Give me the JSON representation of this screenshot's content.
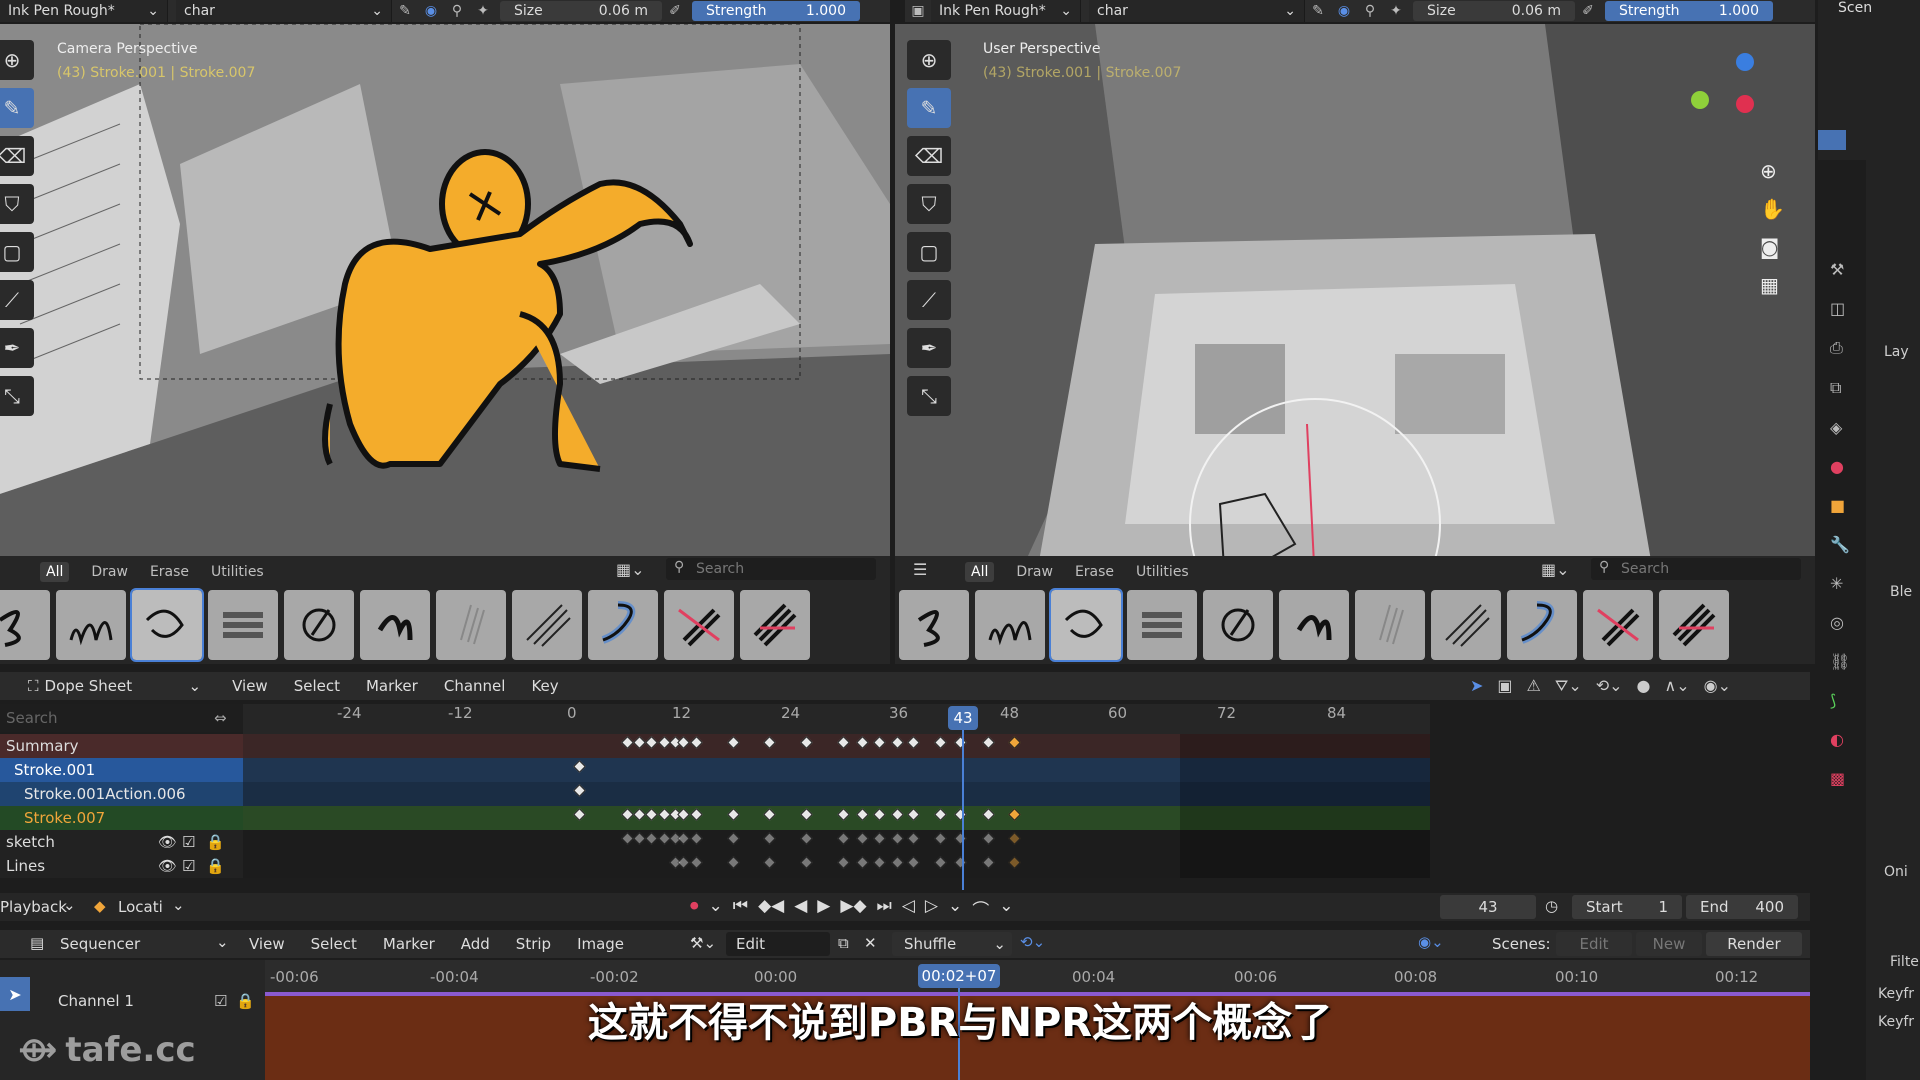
{
  "left_header": {
    "brush": "Ink Pen Rough*",
    "object": "char",
    "size_label": "Size",
    "size_value": "0.06 m",
    "strength_label": "Strength",
    "strength_value": "1.000"
  },
  "right_header": {
    "brush": "Ink Pen Rough*",
    "object": "char",
    "size_label": "Size",
    "size_value": "0.06 m",
    "strength_label": "Strength",
    "strength_value": "1.000"
  },
  "left_viewport": {
    "title": "Camera Perspective",
    "subtitle": "(43) Stroke.001 | Stroke.007"
  },
  "right_viewport": {
    "title": "User Perspective",
    "subtitle": "(43) Stroke.001 | Stroke.007"
  },
  "brush_tabs": [
    "All",
    "Draw",
    "Erase",
    "Utilities"
  ],
  "brush_search_placeholder": "Search",
  "dope": {
    "editor": "Dope Sheet",
    "menu": [
      "View",
      "Select",
      "Marker",
      "Channel",
      "Key"
    ],
    "search_placeholder": "Search",
    "ruler": [
      "-24",
      "-12",
      "0",
      "12",
      "24",
      "36",
      "43",
      "48",
      "60",
      "72",
      "84"
    ],
    "current_frame": "43",
    "channels": [
      "Summary",
      "Stroke.001",
      "Stroke.001Action.006",
      "Stroke.007",
      "sketch",
      "Lines"
    ]
  },
  "playback": {
    "menu": "Playback",
    "keying": "Locati",
    "frame": "43",
    "start_label": "Start",
    "start": "1",
    "end_label": "End",
    "end": "400"
  },
  "sequencer": {
    "editor": "Sequencer",
    "menu": [
      "View",
      "Select",
      "Marker",
      "Add",
      "Strip",
      "Image"
    ],
    "edit": "Edit",
    "shuffle": "Shuffle",
    "scenes_label": "Scenes:",
    "buttons": [
      "Edit",
      "New",
      "Render"
    ],
    "ruler": [
      "-00:06",
      "-00:04",
      "-00:02",
      "00:00",
      "00:02+07",
      "00:04",
      "00:06",
      "00:08",
      "00:10",
      "00:12"
    ],
    "channel": "Channel 1"
  },
  "subtitle": "这就不得不说到PBR与NPR这两个概念了",
  "watermark": "tafe.cc",
  "props": {
    "scene": "Scen",
    "layer": "Lay",
    "ble": "Ble",
    "filter": "Filter",
    "keyfr1": "Keyfr",
    "keyfr2": "Keyfr",
    "oni": "Oni"
  },
  "colors": {
    "accent": "#4772b3",
    "keyframe": "#e8e8e8",
    "keyframe_selected": "#f0a53a",
    "character": "#f4ac2b"
  }
}
